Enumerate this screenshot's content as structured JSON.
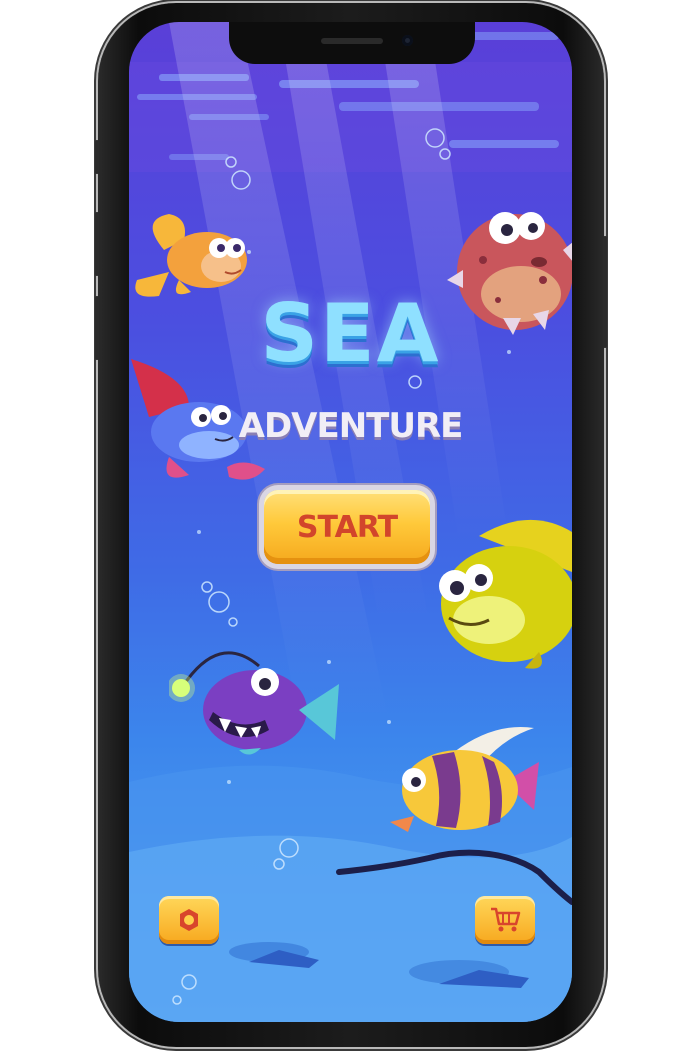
{
  "game": {
    "title": "SEA",
    "subtitle": "ADVENTURE",
    "start_label": "START"
  },
  "buttons": {
    "settings_icon": "gear-icon",
    "shop_icon": "shopping-cart-icon"
  },
  "colors": {
    "title": "#8fe0ff",
    "subtitle": "#f1eef6",
    "start_text": "#d2452b",
    "button_fill": "#ffc93a"
  }
}
